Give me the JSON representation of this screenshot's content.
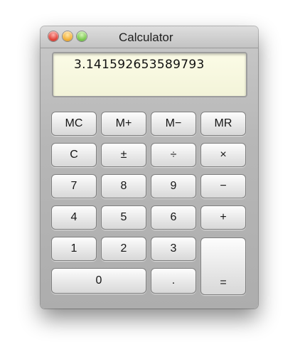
{
  "window": {
    "title": "Calculator",
    "controls": {
      "close": "close-button",
      "minimize": "minimize-button",
      "zoom": "zoom-button"
    }
  },
  "display": {
    "value": "3.141592653589793"
  },
  "keys": {
    "mc": "MC",
    "mplus": "M+",
    "mminus": "M−",
    "mr": "MR",
    "clear": "C",
    "sign": "±",
    "divide": "÷",
    "multiply": "×",
    "seven": "7",
    "eight": "8",
    "nine": "9",
    "subtract": "−",
    "four": "4",
    "five": "5",
    "six": "6",
    "add": "+",
    "one": "1",
    "two": "2",
    "three": "3",
    "zero": "0",
    "decimal": ".",
    "equals": "="
  },
  "colors": {
    "display_background": "#f7f8df",
    "window_body": "#b7b7b7",
    "close_light": "#e0443a",
    "minimize_light": "#f2b13a",
    "zoom_light": "#7bc950"
  }
}
